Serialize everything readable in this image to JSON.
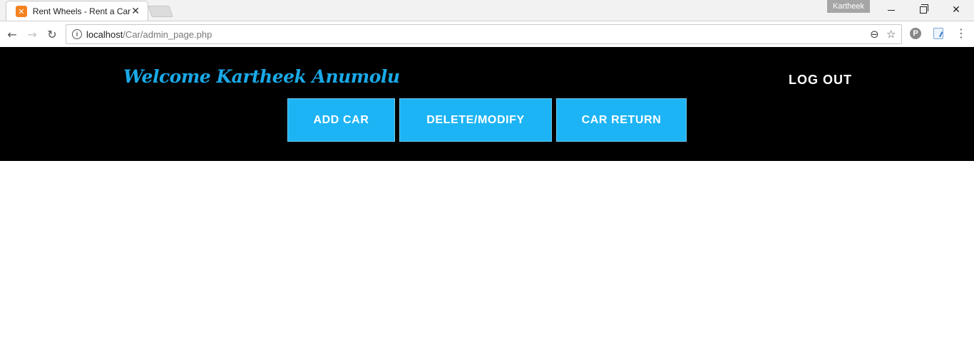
{
  "browser": {
    "tab": {
      "title": "Rent Wheels - Rent a Car",
      "favicon": "xampp-icon"
    },
    "profile_name": "Kartheek",
    "url": {
      "host": "localhost",
      "path": "/Car/admin_page.php"
    },
    "icons": {
      "back": "back-arrow-icon",
      "forward": "forward-arrow-icon",
      "reload": "reload-icon",
      "info": "info-icon",
      "zoom": "zoom-out-icon",
      "bookmark": "star-icon",
      "menu": "kebab-menu-icon"
    }
  },
  "page": {
    "welcome_text": "Welcome Kartheek Anumolu",
    "logout_label": "LOG OUT",
    "buttons": {
      "add_car": "ADD CAR",
      "delete_modify": "DELETE/MODIFY",
      "car_return": "CAR RETURN"
    }
  },
  "colors": {
    "header_bg": "#000000",
    "accent": "#1db4f5",
    "welcome_text": "#1aa9e8"
  }
}
